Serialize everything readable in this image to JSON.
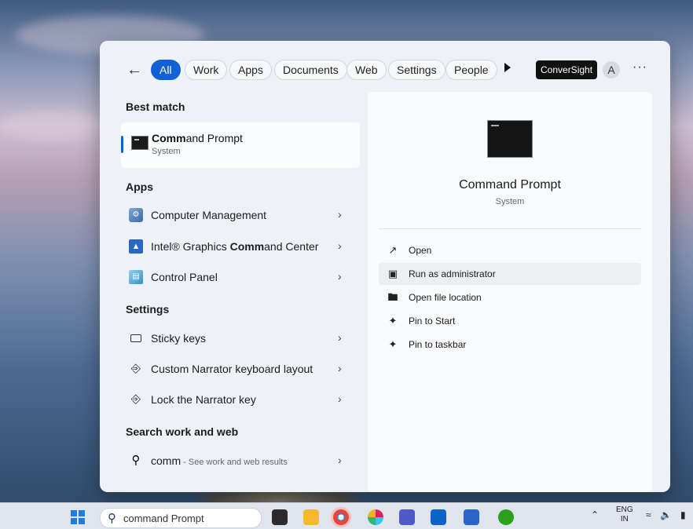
{
  "tabs": [
    "All",
    "Work",
    "Apps",
    "Documents",
    "Web",
    "Settings",
    "People"
  ],
  "brand_label": "ConverSight",
  "avatar_initial": "A",
  "more_label": "···",
  "best_match": {
    "heading": "Best match",
    "title_bold": "Comm",
    "title_rest": "and Prompt",
    "subtitle": "System"
  },
  "apps": {
    "heading": "Apps",
    "items": [
      {
        "pre": "Computer Management",
        "bold": "",
        "post": ""
      },
      {
        "pre": "Intel® Graphics ",
        "bold": "Comm",
        "post": "and Center"
      },
      {
        "pre": "Control Panel",
        "bold": "",
        "post": ""
      }
    ]
  },
  "settings": {
    "heading": "Settings",
    "items": [
      "Sticky keys",
      "Custom Narrator keyboard layout",
      "Lock the Narrator key"
    ]
  },
  "web": {
    "heading": "Search work and web",
    "query": "comm",
    "hint": " - See work and web results"
  },
  "detail": {
    "title": "Command Prompt",
    "subtitle": "System",
    "actions": [
      "Open",
      "Run as administrator",
      "Open file location",
      "Pin to Start",
      "Pin to taskbar"
    ]
  },
  "taskbar": {
    "search_value": "command Prompt",
    "lang_top": "ENG",
    "lang_bottom": "IN"
  },
  "colors": {
    "accent": "#0f62d6"
  }
}
